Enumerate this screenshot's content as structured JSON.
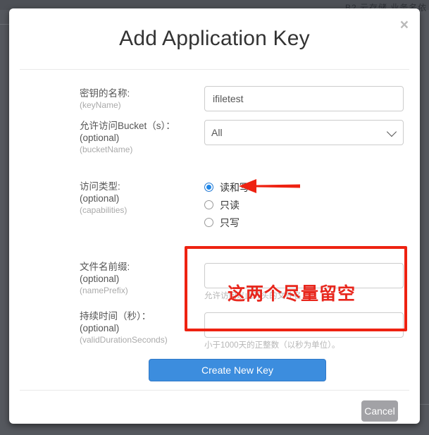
{
  "background": {
    "partial_text": "B2 云存储    业务名依"
  },
  "modal": {
    "title": "Add Application Key",
    "close_icon": "close-icon",
    "fields": [
      {
        "label_main": "密钥的名称:",
        "label_optional": "",
        "label_code": "(keyName)",
        "control": "text",
        "value": "ifiletest",
        "placeholder": "",
        "help": ""
      },
      {
        "label_main": "允许访问Bucket（s）：",
        "label_optional": "(optional)",
        "label_code": "(bucketName)",
        "control": "select",
        "value": "All",
        "options": [
          "All"
        ],
        "help": ""
      },
      {
        "label_main": "访问类型:",
        "label_optional": "(optional)",
        "label_code": "(capabilities)",
        "control": "radio",
        "options": [
          {
            "label": "读和写",
            "checked": true
          },
          {
            "label": "只读",
            "checked": false
          },
          {
            "label": "只写",
            "checked": false
          }
        ]
      },
      {
        "label_main": "文件名前缀:",
        "label_optional": "(optional)",
        "label_code": "(namePrefix)",
        "control": "text",
        "value": "",
        "placeholder": "",
        "help": "允许访问以此开头的文件名"
      },
      {
        "label_main": "持续时间（秒）：",
        "label_optional": "(optional)",
        "label_code": "(validDurationSeconds)",
        "control": "text",
        "value": "",
        "placeholder": "",
        "help": "小于1000天的正整数（以秒为单位）。"
      }
    ],
    "submit_label": "Create New Key",
    "cancel_label": "Cancel"
  },
  "annotations": {
    "box_note": "这两个尽量留空",
    "arrow_target": "读和写",
    "color": "#e8261c"
  }
}
